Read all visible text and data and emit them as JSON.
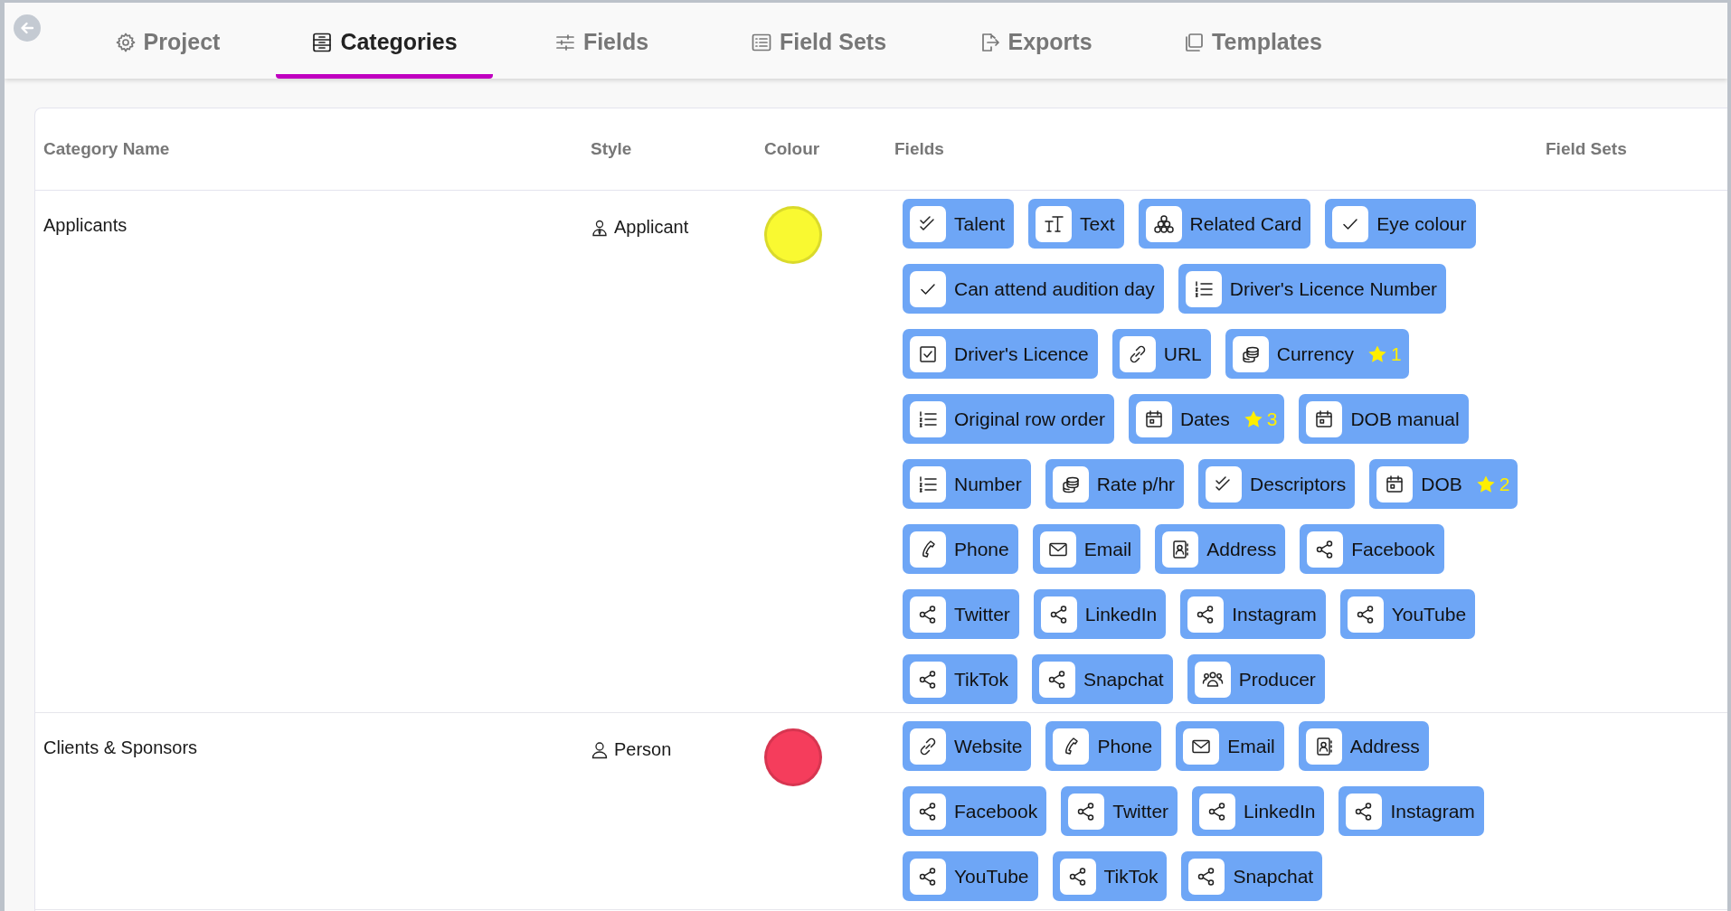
{
  "tabs": [
    {
      "label": "Project",
      "kind": "gear",
      "selected": false
    },
    {
      "label": "Categories",
      "kind": "panel",
      "selected": true
    },
    {
      "label": "Fields",
      "kind": "sliders",
      "selected": false
    },
    {
      "label": "Field Sets",
      "kind": "list",
      "selected": false
    },
    {
      "label": "Exports",
      "kind": "export",
      "selected": false
    },
    {
      "label": "Templates",
      "kind": "copy",
      "selected": false
    }
  ],
  "table": {
    "columns": [
      "Category Name",
      "Style",
      "Colour",
      "Fields",
      "Field Sets"
    ],
    "rows": [
      {
        "name": "Applicants",
        "style": {
          "label": "Applicant",
          "kind": "applicant"
        },
        "color": "#f9f931",
        "fields": [
          {
            "label": "Talent",
            "kind": "checklist"
          },
          {
            "label": "Text",
            "kind": "text"
          },
          {
            "label": "Related Card",
            "kind": "related"
          },
          {
            "label": "Eye colour",
            "kind": "check"
          },
          {
            "label": "Can attend audition day",
            "kind": "check"
          },
          {
            "label": "Driver's Licence Number",
            "kind": "numbered"
          },
          {
            "label": "Driver's Licence",
            "kind": "checkbox"
          },
          {
            "label": "URL",
            "kind": "link"
          },
          {
            "label": "Currency",
            "kind": "currency",
            "badge": "1"
          },
          {
            "label": "Original row order",
            "kind": "numbered"
          },
          {
            "label": "Dates",
            "kind": "date",
            "badge": "3"
          },
          {
            "label": "DOB manual",
            "kind": "date"
          },
          {
            "label": "Number",
            "kind": "numbered"
          },
          {
            "label": "Rate p/hr",
            "kind": "currency"
          },
          {
            "label": "Descriptors",
            "kind": "checklist"
          },
          {
            "label": "DOB",
            "kind": "date",
            "badge": "2"
          },
          {
            "label": "Phone",
            "kind": "phone"
          },
          {
            "label": "Email",
            "kind": "email"
          },
          {
            "label": "Address",
            "kind": "address"
          },
          {
            "label": "Facebook",
            "kind": "social"
          },
          {
            "label": "Twitter",
            "kind": "social"
          },
          {
            "label": "LinkedIn",
            "kind": "social"
          },
          {
            "label": "Instagram",
            "kind": "social"
          },
          {
            "label": "YouTube",
            "kind": "social"
          },
          {
            "label": "TikTok",
            "kind": "social"
          },
          {
            "label": "Snapchat",
            "kind": "social"
          },
          {
            "label": "Producer",
            "kind": "people"
          }
        ]
      },
      {
        "name": "Clients & Sponsors",
        "style": {
          "label": "Person",
          "kind": "person"
        },
        "color": "#f53d5c",
        "fields": [
          {
            "label": "Website",
            "kind": "link"
          },
          {
            "label": "Phone",
            "kind": "phone"
          },
          {
            "label": "Email",
            "kind": "email"
          },
          {
            "label": "Address",
            "kind": "address"
          },
          {
            "label": "Facebook",
            "kind": "social"
          },
          {
            "label": "Twitter",
            "kind": "social"
          },
          {
            "label": "LinkedIn",
            "kind": "social"
          },
          {
            "label": "Instagram",
            "kind": "social"
          },
          {
            "label": "YouTube",
            "kind": "social"
          },
          {
            "label": "TikTok",
            "kind": "social"
          },
          {
            "label": "Snapchat",
            "kind": "social"
          }
        ]
      }
    ]
  }
}
